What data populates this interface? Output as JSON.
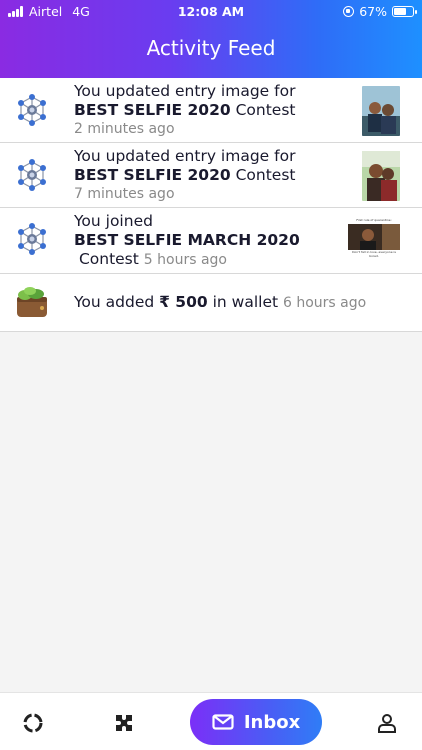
{
  "status": {
    "carrier": "Airtel",
    "network": "4G",
    "time": "12:08 AM",
    "battery": "67%",
    "battery_level": 0.67
  },
  "header": {
    "title": "Activity Feed"
  },
  "feed": [
    {
      "line1": "You updated entry image for",
      "contest": "BEST SELFIE 2020",
      "suffix": " Contest",
      "time": "2 minutes ago",
      "icon": "network-icon"
    },
    {
      "line1": "You updated entry image for",
      "contest": "BEST SELFIE 2020",
      "suffix": " Contest",
      "time": "7 minutes ago",
      "icon": "network-icon"
    },
    {
      "line1": "You joined",
      "contest": "BEST SELFIE MARCH 2020",
      "suffix": "Contest",
      "time": "5 hours ago",
      "icon": "network-icon",
      "thumb_caption_top": "First rule of quarantine:",
      "thumb_caption_bottom": "Don't fall in love, everyone is bored."
    },
    {
      "prefix": "You added ",
      "amount": "₹ 500",
      "suffix": " in wallet",
      "time": "6 hours ago",
      "icon": "wallet-icon"
    }
  ],
  "nav": {
    "inbox_label": "Inbox",
    "items": [
      "activity-icon",
      "puzzle-icon",
      "mail-icon",
      "profile-icon"
    ]
  },
  "colors": {
    "gradient_start": "#8a2be2",
    "gradient_end": "#1e90ff",
    "time_gray": "#8a8a8a"
  }
}
